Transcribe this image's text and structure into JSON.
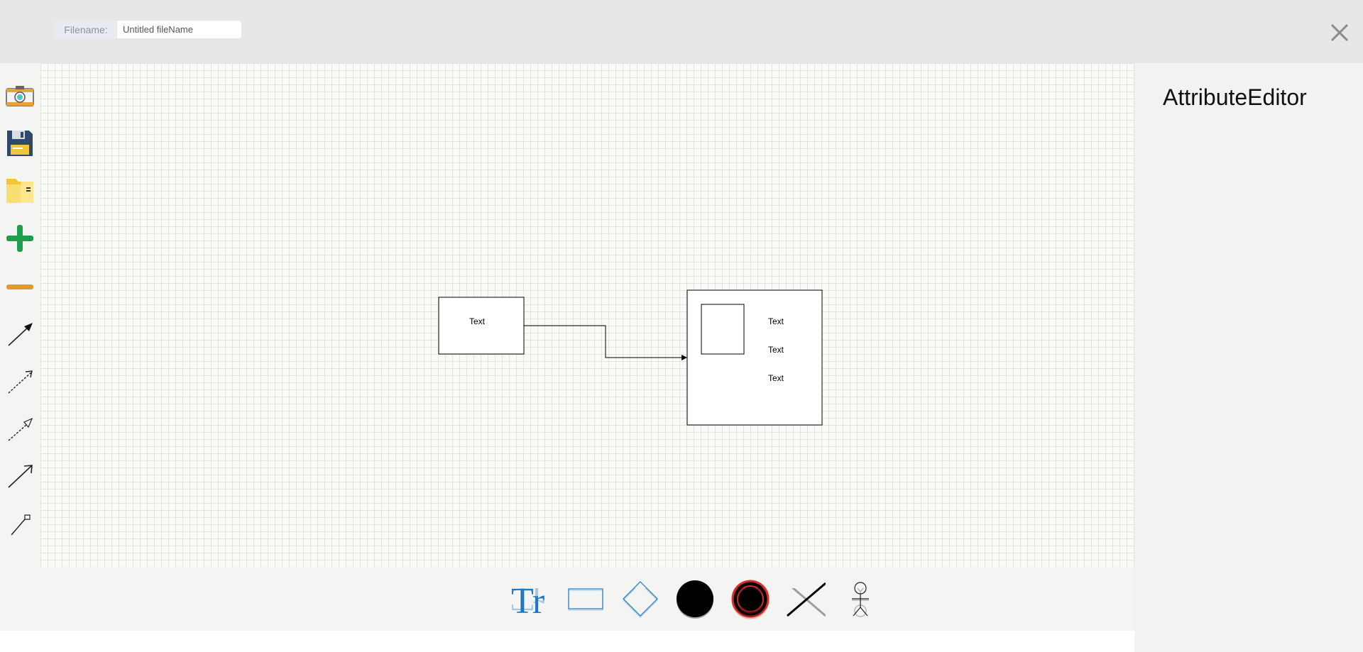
{
  "header": {
    "filename_label": "Filename:",
    "filename_value": "Untitled fileName"
  },
  "left_toolbar": {
    "tools": [
      {
        "name": "camera-icon"
      },
      {
        "name": "save-icon"
      },
      {
        "name": "folder-icon"
      },
      {
        "name": "zoom-in-icon"
      },
      {
        "name": "zoom-out-icon"
      },
      {
        "name": "solid-arrow-icon"
      },
      {
        "name": "dashed-open-arrow-icon"
      },
      {
        "name": "dashed-triangle-arrow-icon"
      },
      {
        "name": "open-arrow-icon"
      },
      {
        "name": "diamond-arrow-icon"
      }
    ]
  },
  "canvas": {
    "box1_text": "Text",
    "box2_texts": [
      "Text",
      "Text",
      "Text"
    ]
  },
  "attribute_editor": {
    "title": "AttributeEditor"
  },
  "shape_palette": {
    "items": [
      "text-tool-icon",
      "rectangle-tool-icon",
      "diamond-tool-icon",
      "circle-tool-icon",
      "final-state-tool-icon",
      "line-tool-icon",
      "actor-tool-icon"
    ],
    "text_glyph": "Tr"
  },
  "colors": {
    "accent_blue": "#1e78c2",
    "red": "#d9302e",
    "green": "#1e9e4a",
    "orange": "#e09a2e"
  }
}
